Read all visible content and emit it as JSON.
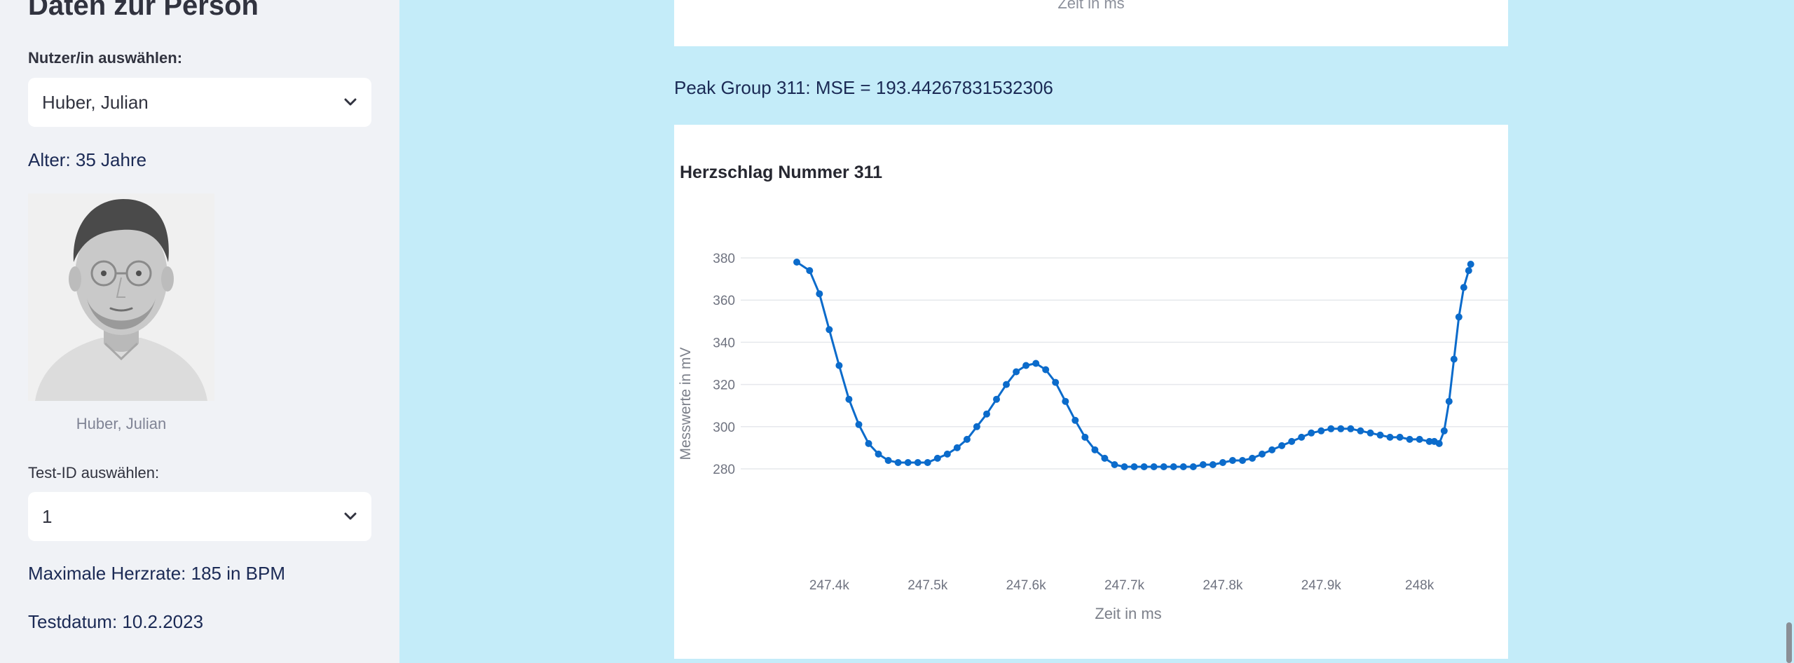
{
  "sidebar": {
    "heading": "Daten zur Person",
    "user_select_label": "Nutzer/in auswählen:",
    "user_select_value": "Huber, Julian",
    "age_text": "Alter: 35 Jahre",
    "avatar_caption": "Huber, Julian",
    "test_select_label": "Test-ID auswählen:",
    "test_select_value": "1",
    "max_hr_text": "Maximale Herzrate: 185 in BPM",
    "test_date_text": "Testdatum: 10.2.2023"
  },
  "main": {
    "top_chart_xlabel": "Zeit in ms",
    "peak_group_text": "Peak Group 311: MSE = 193.44267831532306"
  },
  "colors": {
    "sidebar_bg": "#f0f2f6",
    "main_bg": "#c4ecf9",
    "series_color": "#0b6bcb"
  },
  "chart_data": {
    "type": "line",
    "title": "Herzschlag Nummer 311",
    "xlabel": "Zeit in ms",
    "ylabel": "Messwerte in mV",
    "xlim": [
      247310,
      248090
    ],
    "ylim": [
      274,
      386
    ],
    "x_ticks": [
      247400,
      247500,
      247600,
      247700,
      247800,
      247900,
      248000
    ],
    "x_tick_labels": [
      "247.4k",
      "247.5k",
      "247.6k",
      "247.7k",
      "247.8k",
      "247.9k",
      "248k"
    ],
    "y_ticks": [
      280,
      300,
      320,
      340,
      360,
      380
    ],
    "grid": true,
    "legend": false,
    "series": [
      {
        "color": "#0b6bcb",
        "markers": true,
        "x": [
          247367,
          247380,
          247390,
          247400,
          247410,
          247420,
          247430,
          247440,
          247450,
          247460,
          247470,
          247480,
          247490,
          247500,
          247510,
          247520,
          247530,
          247540,
          247550,
          247560,
          247570,
          247580,
          247590,
          247600,
          247610,
          247620,
          247630,
          247640,
          247650,
          247660,
          247670,
          247680,
          247690,
          247700,
          247710,
          247720,
          247730,
          247740,
          247750,
          247760,
          247770,
          247780,
          247790,
          247800,
          247810,
          247820,
          247830,
          247840,
          247850,
          247860,
          247870,
          247880,
          247890,
          247900,
          247910,
          247920,
          247930,
          247940,
          247950,
          247960,
          247970,
          247980,
          247990,
          248000,
          248010,
          248015,
          248020,
          248025,
          248030,
          248035,
          248040,
          248045,
          248050,
          248052
        ],
        "y": [
          378,
          374,
          363,
          346,
          329,
          313,
          301,
          292,
          287,
          284,
          283,
          283,
          283,
          283,
          285,
          287,
          290,
          294,
          300,
          306,
          313,
          320,
          326,
          329,
          330,
          327,
          321,
          312,
          303,
          295,
          289,
          285,
          282,
          281,
          281,
          281,
          281,
          281,
          281,
          281,
          281,
          282,
          282,
          283,
          284,
          284,
          285,
          287,
          289,
          291,
          293,
          295,
          297,
          298,
          299,
          299,
          299,
          298,
          297,
          296,
          295,
          295,
          294,
          294,
          293,
          293,
          292,
          298,
          312,
          332,
          352,
          366,
          374,
          377
        ]
      }
    ]
  }
}
